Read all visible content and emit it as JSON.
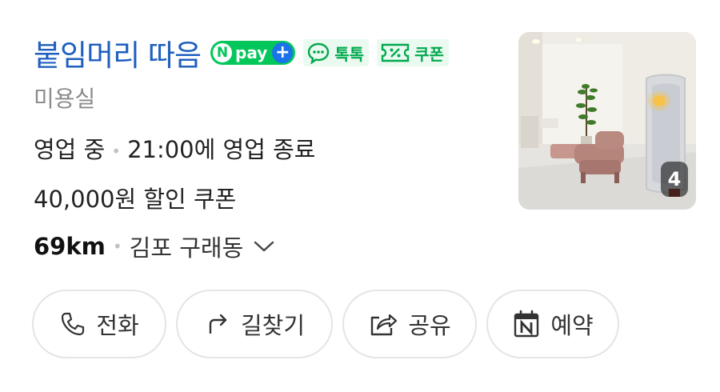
{
  "place": {
    "name": "붙임머리 따음",
    "npay_n": "N",
    "npay_label": "pay",
    "npay_plus": "+",
    "talk_label": "톡톡",
    "coupon_tag_label": "쿠폰",
    "category": "미용실",
    "status": "영업 중",
    "hours_separator": "•",
    "hours_detail": "21:00에 영업 종료",
    "coupon_text": "40,000원 할인 쿠폰",
    "distance": "69km",
    "address": "김포 구래동",
    "photo_count": "4"
  },
  "actions": {
    "call": "전화",
    "directions": "길찾기",
    "share": "공유",
    "booking": "예약"
  },
  "colors": {
    "title": "#1f5fbf",
    "naver_green": "#03c75a",
    "plus_blue": "#1a73e8"
  },
  "icons": {
    "call": "phone-icon",
    "directions": "turn-arrow-icon",
    "share": "share-icon",
    "booking": "naver-calendar-icon",
    "address_toggle": "chevron-down-icon"
  }
}
